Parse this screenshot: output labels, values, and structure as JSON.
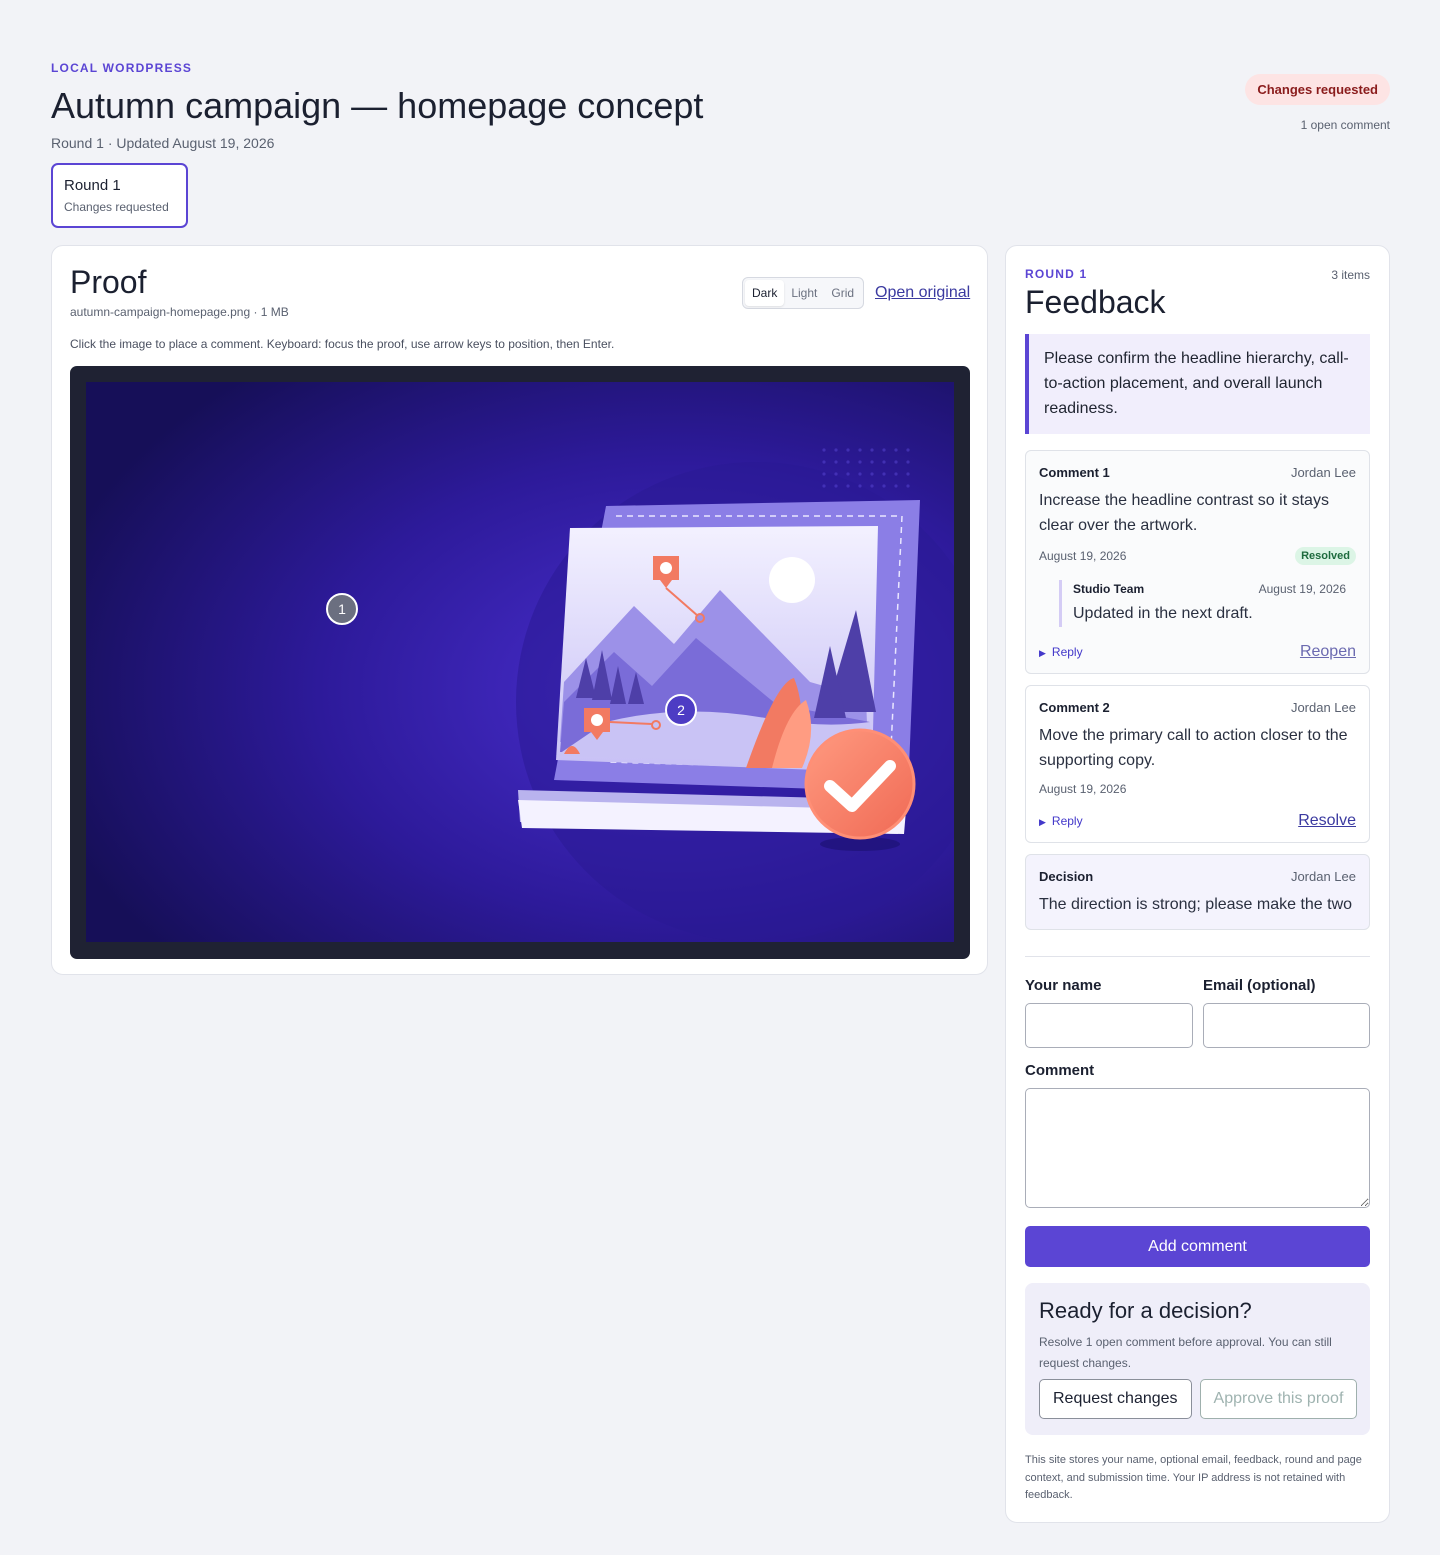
{
  "header": {
    "site_label": "LOCAL WORDPRESS",
    "title": "Autumn campaign — homepage concept",
    "meta": "Round 1 · Updated August 19, 2026",
    "status": "Changes requested",
    "open_count": "1 open comment"
  },
  "rounds": [
    {
      "title": "Round 1",
      "status": "Changes requested"
    }
  ],
  "proof": {
    "title": "Proof",
    "file": "autumn-campaign-homepage.png · 1 MB",
    "help": "Click the image to place a comment. Keyboard: focus the proof, use arrow keys to position, then Enter.",
    "modes": [
      "Dark",
      "Light",
      "Grid"
    ],
    "active_mode": "Dark",
    "open_original": "Open original",
    "pins": [
      {
        "label": "1",
        "state": "resolved",
        "color": "#6b6f80"
      },
      {
        "label": "2",
        "state": "open",
        "color": "#4d3cc4"
      }
    ]
  },
  "feedback": {
    "round": "ROUND 1",
    "count": "3 items",
    "title": "Feedback",
    "brief": "Please confirm the headline hierarchy, call-to-action placement, and overall launch readiness.",
    "comments": [
      {
        "label": "Comment 1",
        "author": "Jordan Lee",
        "body": "Increase the headline contrast so it stays clear over the artwork.",
        "date": "August 19, 2026",
        "badge": "Resolved",
        "reply": {
          "author": "Studio Team",
          "date": "August 19, 2026",
          "body": "Updated in the next draft."
        },
        "reply_toggle": "Reply",
        "action": "Reopen"
      },
      {
        "label": "Comment 2",
        "author": "Jordan Lee",
        "body": "Move the primary call to action closer to the supporting copy.",
        "date": "August 19, 2026",
        "reply_toggle": "Reply",
        "action": "Resolve"
      },
      {
        "label": "Decision",
        "author": "Jordan Lee",
        "body": "The direction is strong; please make the two"
      }
    ]
  },
  "form": {
    "name_label": "Your name",
    "email_label": "Email (optional)",
    "comment_label": "Comment",
    "name_value": "",
    "email_value": "",
    "comment_value": "",
    "submit": "Add comment"
  },
  "decision": {
    "title": "Ready for a decision?",
    "text": "Resolve 1 open comment before approval. You can still request changes.",
    "request_changes": "Request changes",
    "approve": "Approve this proof"
  },
  "privacy": "This site stores your name, optional email, feedback, round and page context, and submission time. Your IP address is not retained with feedback.",
  "colors": {
    "accent": "#5b45d4",
    "status_bg": "#fde4e4",
    "status_text": "#8a1c1c",
    "resolved_bg": "#dcf5e6",
    "resolved_text": "#1e6b3e"
  }
}
